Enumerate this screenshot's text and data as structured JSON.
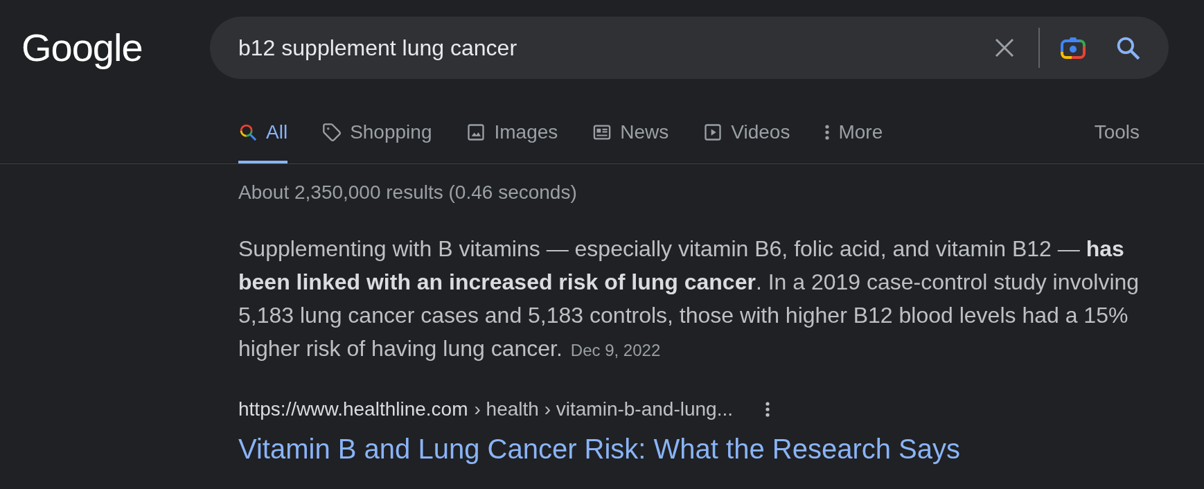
{
  "header": {
    "logo": "Google",
    "search": {
      "value": "b12 supplement lung cancer"
    }
  },
  "tabs": [
    {
      "kind": "all",
      "label": "All",
      "selected": true
    },
    {
      "kind": "shopping",
      "label": "Shopping",
      "selected": false
    },
    {
      "kind": "images",
      "label": "Images",
      "selected": false
    },
    {
      "kind": "news",
      "label": "News",
      "selected": false
    },
    {
      "kind": "videos",
      "label": "Videos",
      "selected": false
    },
    {
      "kind": "more",
      "label": "More",
      "selected": false
    }
  ],
  "tools": "Tools",
  "result_stats": "About 2,350,000 results (0.46 seconds)",
  "featured_snippet": {
    "text": "Supplementing with B vitamins — especially vitamin B6, folic acid, and vitamin B12 — **has been linked with an increased risk of lung cancer**. In a 2019 case-control study involving 5,183 lung cancer cases and 5,183 controls, those with higher B12 blood levels had a 15% higher risk of having lung cancer.",
    "date": "Dec 9, 2022"
  },
  "result": {
    "site": "https://www.healthline.com",
    "path": "› health › vitamin-b-and-lung...",
    "title": "Vitamin B and Lung Cancer Risk: What the Research Says"
  }
}
